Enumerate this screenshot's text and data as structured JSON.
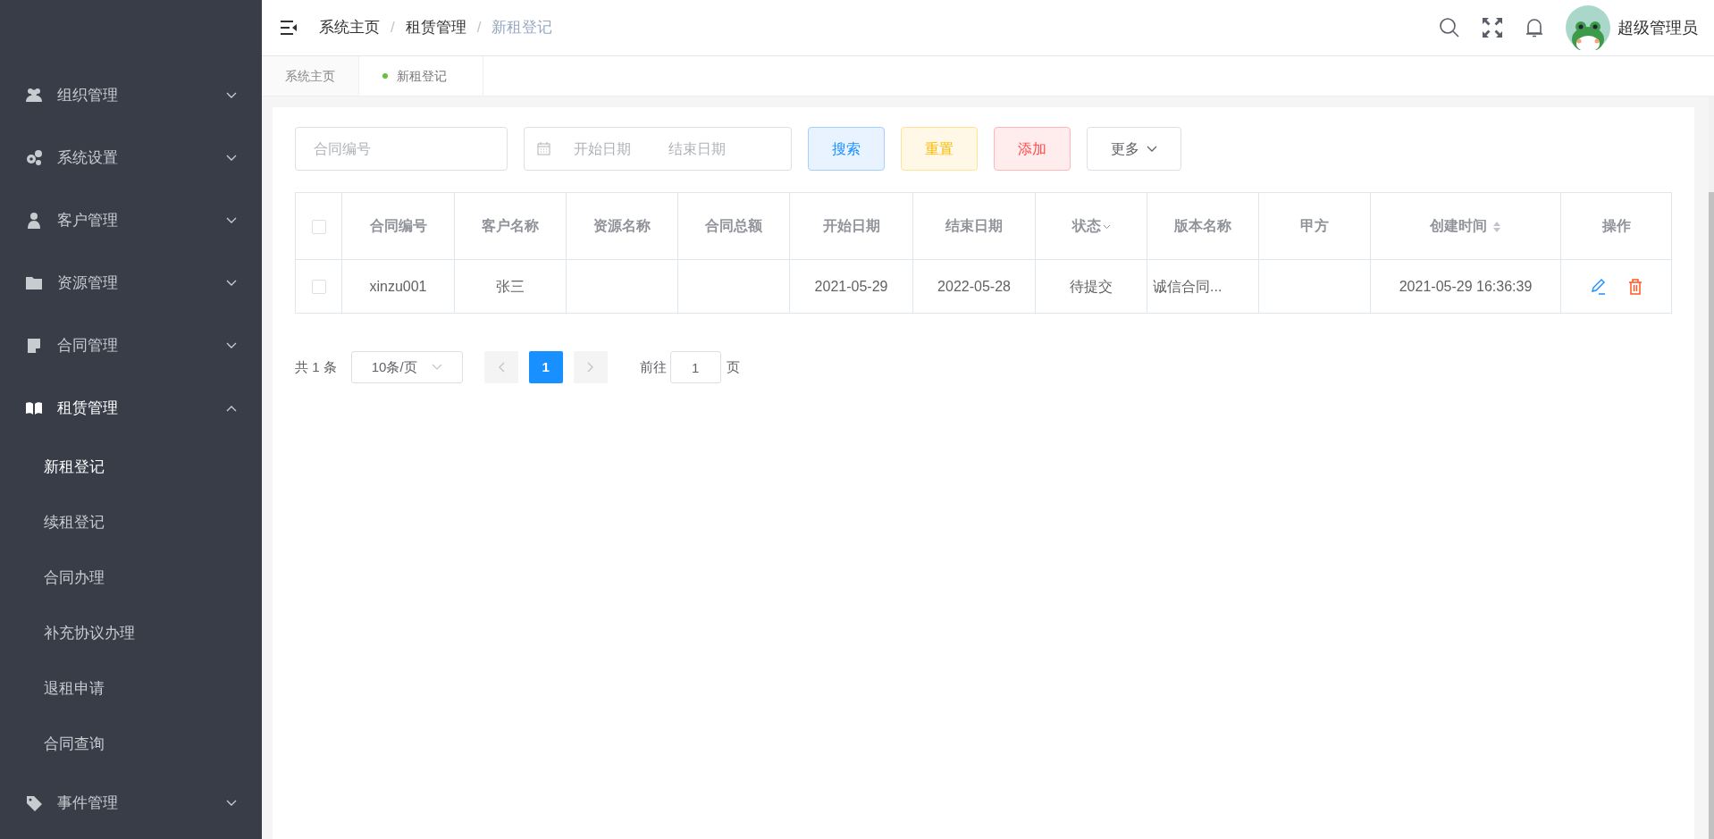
{
  "sidebar": {
    "groups": [
      {
        "label": "组织管理",
        "expanded": false
      },
      {
        "label": "系统设置",
        "expanded": false
      },
      {
        "label": "客户管理",
        "expanded": false
      },
      {
        "label": "资源管理",
        "expanded": false
      },
      {
        "label": "合同管理",
        "expanded": false
      },
      {
        "label": "租赁管理",
        "expanded": true,
        "children": [
          {
            "label": "新租登记",
            "selected": true
          },
          {
            "label": "续租登记",
            "selected": false
          },
          {
            "label": "合同办理",
            "selected": false
          },
          {
            "label": "补充协议办理",
            "selected": false
          },
          {
            "label": "退租申请",
            "selected": false
          },
          {
            "label": "合同查询",
            "selected": false
          }
        ]
      },
      {
        "label": "事件管理",
        "expanded": false
      }
    ]
  },
  "header": {
    "breadcrumb": [
      "系统主页",
      "租赁管理",
      "新租登记"
    ],
    "breadcrumb_separators": [
      "/",
      "/"
    ],
    "user": "超级管理员"
  },
  "tabs": [
    {
      "label": "系统主页",
      "selected": false
    },
    {
      "label": "新租登记",
      "selected": true
    }
  ],
  "filters": {
    "contract_no": {
      "placeholder": "合同编号"
    },
    "start_date": {
      "placeholder": "开始日期"
    },
    "end_date": {
      "placeholder": "结束日期"
    }
  },
  "buttons": [
    {
      "label": "搜索",
      "kind": "search"
    },
    {
      "label": "重置",
      "kind": "reset"
    },
    {
      "label": "添加",
      "kind": "add"
    },
    {
      "label": "更多",
      "kind": "more"
    }
  ],
  "table": {
    "columns": [
      {
        "label": "合同编号",
        "kind": "plain"
      },
      {
        "label": "客户名称",
        "kind": "plain"
      },
      {
        "label": "资源名称",
        "kind": "plain"
      },
      {
        "label": "合同总额",
        "kind": "plain"
      },
      {
        "label": "开始日期",
        "kind": "plain"
      },
      {
        "label": "结束日期",
        "kind": "plain"
      },
      {
        "label": "状态",
        "kind": "filter"
      },
      {
        "label": "版本名称",
        "kind": "plain"
      },
      {
        "label": "甲方",
        "kind": "plain"
      },
      {
        "label": "创建时间",
        "kind": "sort"
      },
      {
        "label": "操作",
        "kind": "plain"
      }
    ],
    "header_checked": false,
    "rows": [
      {
        "checked": false,
        "cells": [
          "xinzu001",
          "张三",
          "",
          "",
          "2021-05-29",
          "2022-05-28",
          "待提交",
          "诚信合同...",
          "",
          "2021-05-29 16:36:39"
        ]
      }
    ]
  },
  "pagination": {
    "total": "共 1 条",
    "page_size": "10条/页",
    "pages": [
      {
        "label": "1",
        "selected": true
      }
    ],
    "goto_label": "前往",
    "goto_value": "1",
    "goto_suffix": "页"
  }
}
